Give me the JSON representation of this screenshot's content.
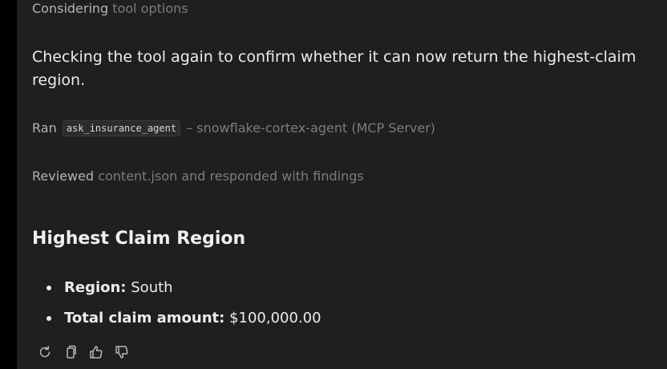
{
  "steps": {
    "considering": {
      "lead": "Considering",
      "rest": "tool options"
    },
    "ran": {
      "lead": "Ran",
      "tool": "ask_insurance_agent",
      "rest": "– snowflake-cortex-agent (MCP Server)"
    },
    "reviewed": {
      "lead": "Reviewed",
      "rest": "content.json and responded with findings"
    }
  },
  "message": "Checking the tool again to confirm whether it can now return the highest-claim region.",
  "result": {
    "heading": "Highest Claim Region",
    "items": [
      {
        "label": "Region:",
        "value": "South"
      },
      {
        "label": "Total claim amount:",
        "value": "$100,000.00"
      }
    ]
  },
  "actions": [
    "retry-icon",
    "copy-icon",
    "thumbs-up-icon",
    "thumbs-down-icon"
  ],
  "colors": {
    "panel": "#1f1f1f",
    "text": "#ececec",
    "muted": "#8a8a8a",
    "chip": "#2c2c2c"
  }
}
